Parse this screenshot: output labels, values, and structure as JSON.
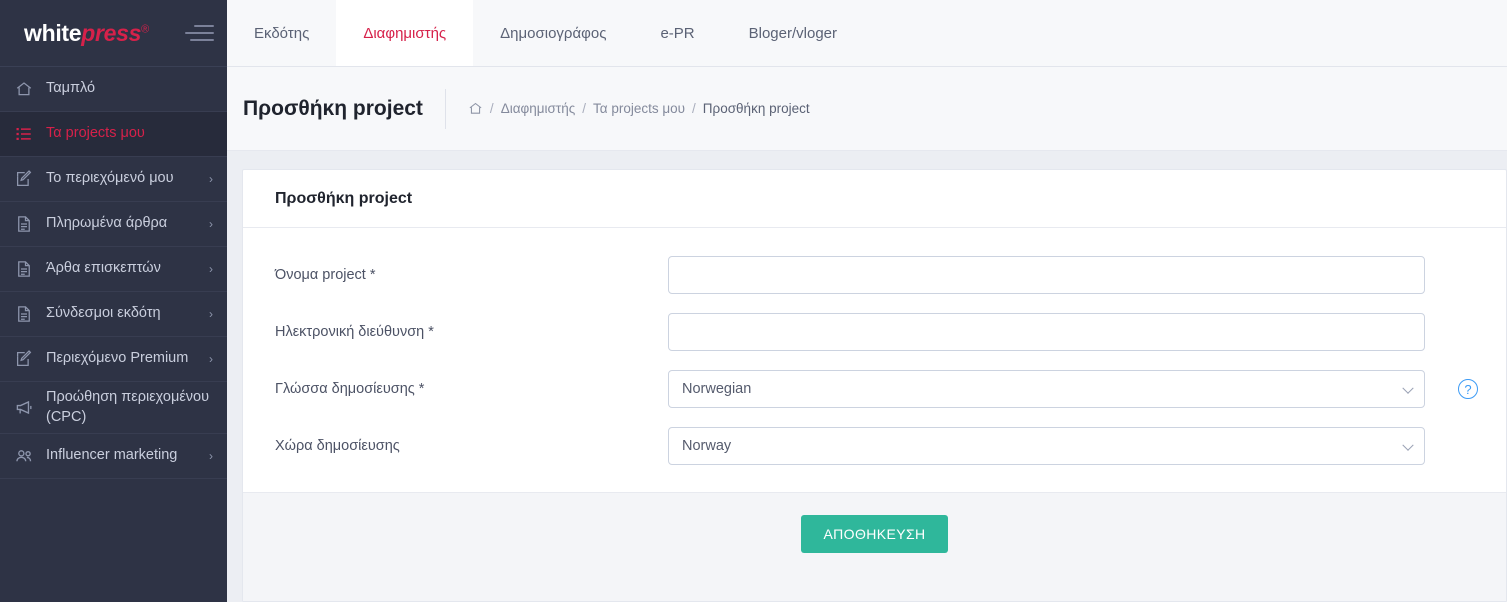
{
  "brand": {
    "text_white": "white",
    "text_red": "press",
    "registered": "®",
    "menu_icon": "hamburger-icon"
  },
  "sidebar": {
    "items": [
      {
        "label": "Ταμπλό",
        "icon": "home-icon",
        "active": false,
        "chevron": ""
      },
      {
        "label": "Τα projects μου",
        "icon": "list-icon",
        "active": true,
        "chevron": ""
      },
      {
        "label": "Το περιεχόμενό μου",
        "icon": "edit-icon",
        "active": false,
        "chevron": "›"
      },
      {
        "label": "Πληρωμένα άρθρα",
        "icon": "document-icon",
        "active": false,
        "chevron": "›"
      },
      {
        "label": "Άρθα επισκεπτών",
        "icon": "document-icon",
        "active": false,
        "chevron": "›"
      },
      {
        "label": "Σύνδεσμοι εκδότη",
        "icon": "document-icon",
        "active": false,
        "chevron": "›"
      },
      {
        "label": "Περιεχόμενο Premium",
        "icon": "edit-icon",
        "active": false,
        "chevron": "›"
      },
      {
        "label": "Προώθηση περιεχομένου (CPC)",
        "icon": "megaphone-icon",
        "active": false,
        "chevron": ""
      },
      {
        "label": "Influencer marketing",
        "icon": "users-icon",
        "active": false,
        "chevron": "›"
      }
    ]
  },
  "topbar": {
    "tabs": [
      {
        "label": "Εκδότης",
        "active": false
      },
      {
        "label": "Διαφημιστής",
        "active": true
      },
      {
        "label": "Δημοσιογράφος",
        "active": false
      },
      {
        "label": "e-PR",
        "active": false
      },
      {
        "label": "Bloger/vloger",
        "active": false
      }
    ]
  },
  "pagehead": {
    "title": "Προσθήκη project",
    "breadcrumb": {
      "home_icon": "home-icon",
      "items": [
        "Διαφημιστής",
        "Τα projects μου",
        "Προσθήκη project"
      ],
      "separator": "/"
    }
  },
  "card": {
    "title": "Προσθήκη project",
    "fields": [
      {
        "label": "Όνομα project *",
        "type": "text",
        "value": "",
        "placeholder": ""
      },
      {
        "label": "Ηλεκτρονική διεύθυνση *",
        "type": "text",
        "value": "",
        "placeholder": ""
      },
      {
        "label": "Γλώσσα δημοσίευσης *",
        "type": "select",
        "value": "Norwegian",
        "help": "?"
      },
      {
        "label": "Χώρα δημοσίευσης",
        "type": "select",
        "value": "Norway"
      }
    ],
    "save_label": "ΑΠΟΘΗΚΕΥΣΗ"
  },
  "colors": {
    "sidebar_bg": "#2e3345",
    "accent_red": "#d6214a",
    "save_green": "#2fb79b",
    "help_blue": "#3d9bf5",
    "page_bg": "#eceef3"
  }
}
